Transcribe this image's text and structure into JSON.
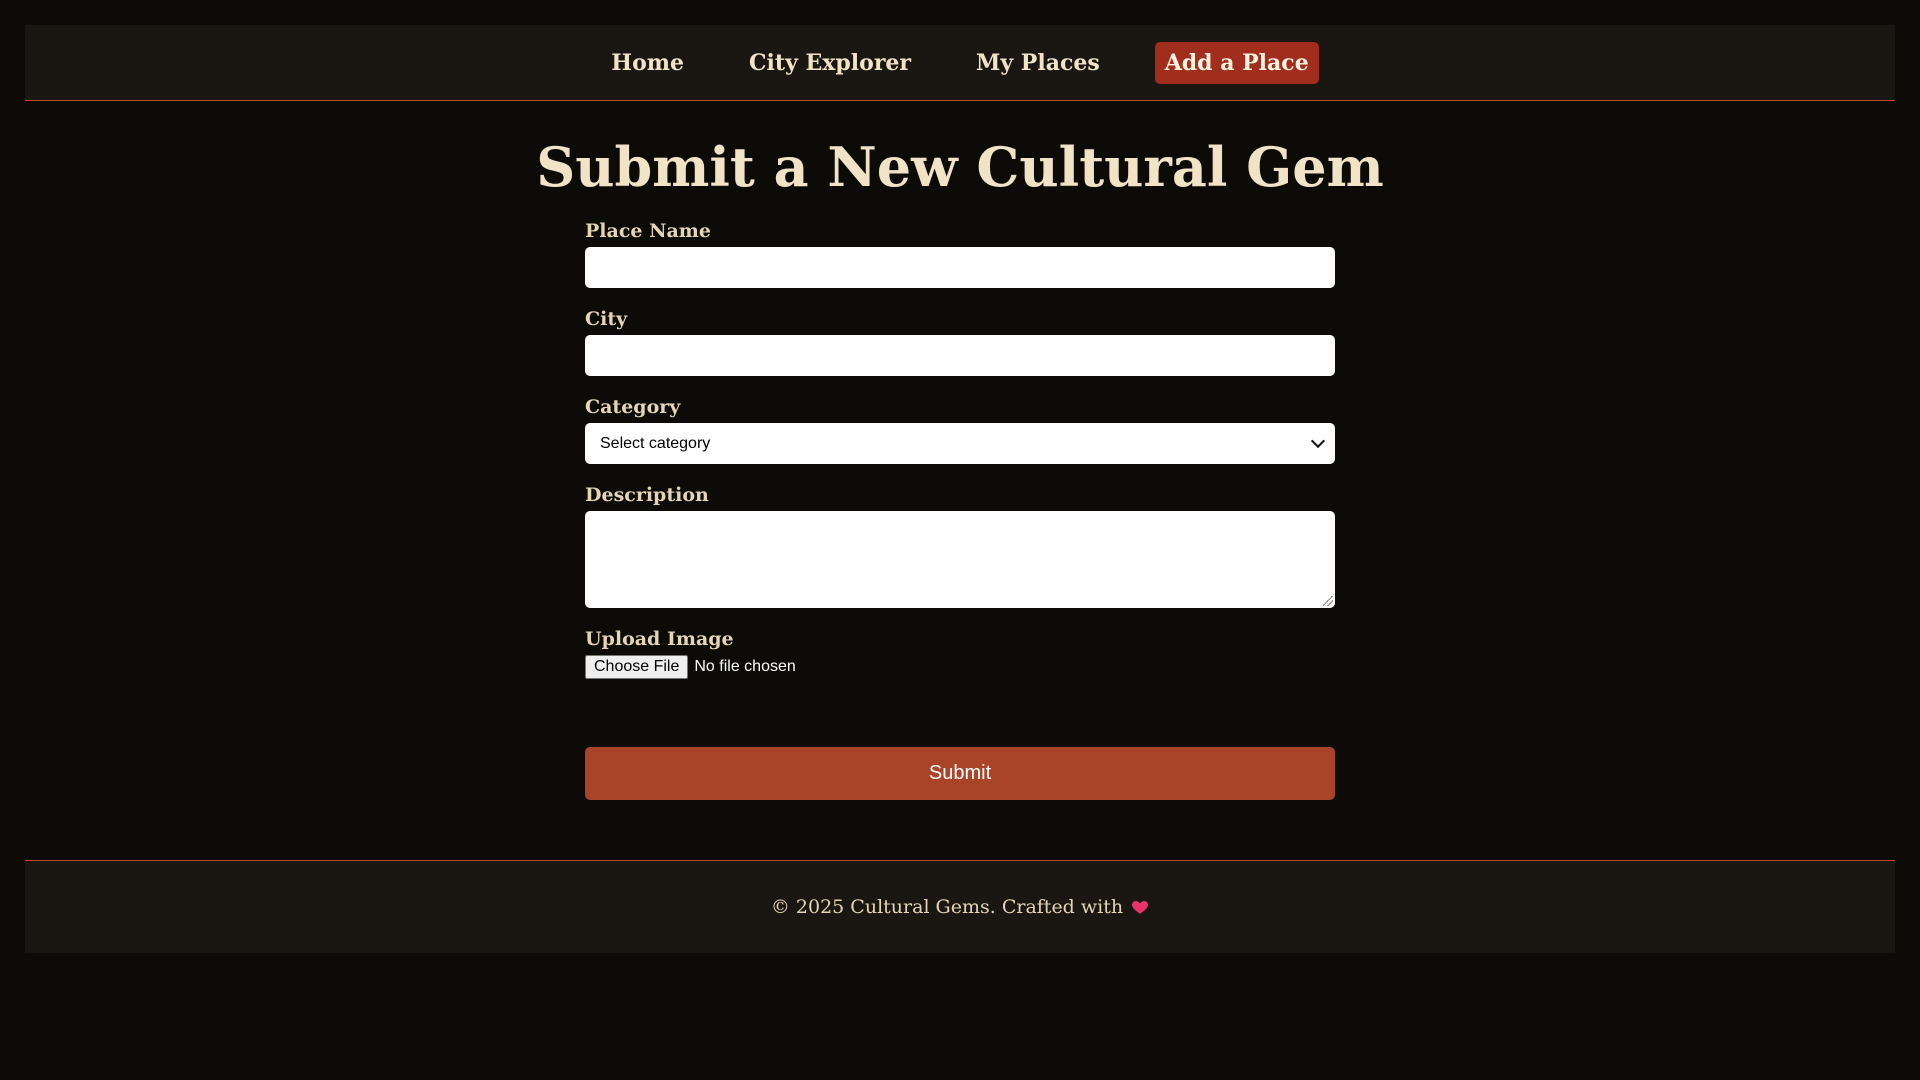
{
  "nav": {
    "items": [
      {
        "label": "Home",
        "active": false
      },
      {
        "label": "City Explorer",
        "active": false
      },
      {
        "label": "My Places",
        "active": false
      },
      {
        "label": "Add a Place",
        "active": true
      }
    ]
  },
  "main": {
    "title": "Submit a New Cultural Gem",
    "form": {
      "place_name": {
        "label": "Place Name",
        "value": ""
      },
      "city": {
        "label": "City",
        "value": ""
      },
      "category": {
        "label": "Category",
        "selected": "Select category"
      },
      "description": {
        "label": "Description",
        "value": ""
      },
      "upload": {
        "label": "Upload Image",
        "button": "Choose File",
        "status": "No file chosen"
      },
      "submit_label": "Submit"
    }
  },
  "footer": {
    "text": "© 2025 Cultural Gems. Crafted with",
    "icon": "heart-icon"
  },
  "colors": {
    "background": "#0d0b08",
    "surface": "#1a1713",
    "accent": "#a94428",
    "active_nav": "#a12d1d",
    "heart": "#e8346b"
  }
}
